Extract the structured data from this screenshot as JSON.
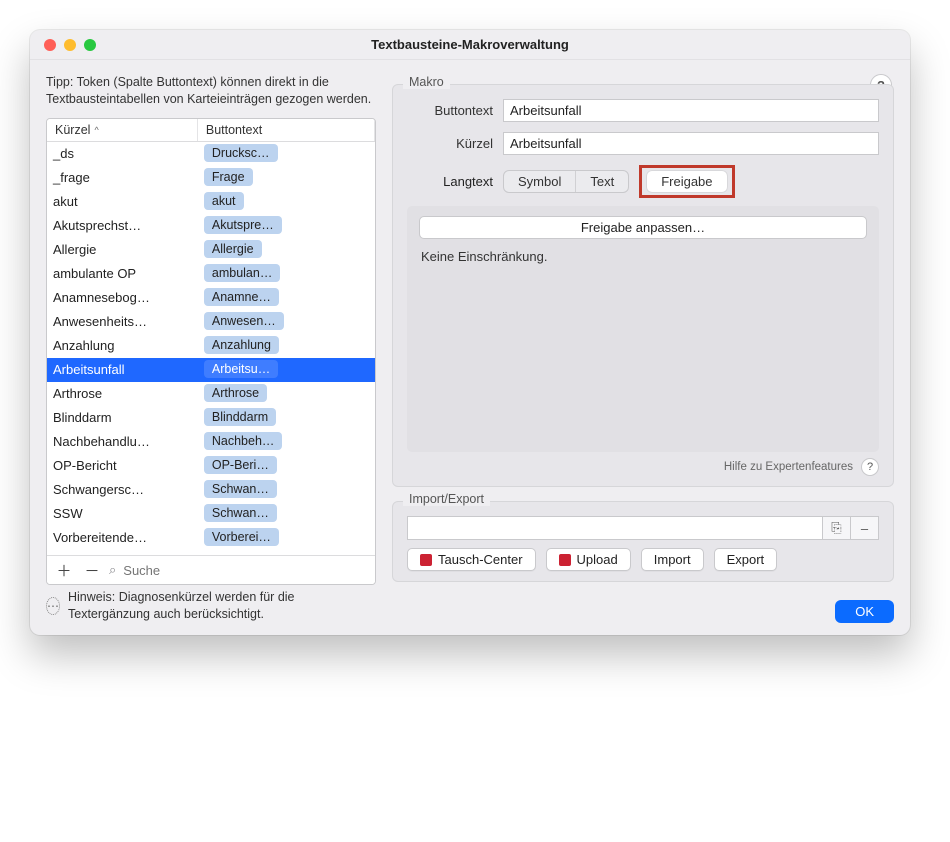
{
  "window": {
    "title": "Textbausteine-Makroverwaltung"
  },
  "left": {
    "tip": "Tipp: Token (Spalte Buttontext) können direkt in die Textbausteintabellen von Karteieinträgen gezogen werden.",
    "columns": {
      "c1": "Kürzel",
      "c2": "Buttontext"
    },
    "sort": "^",
    "rows": [
      {
        "kuerzel": "_ds",
        "button": "Drucksc…"
      },
      {
        "kuerzel": "_frage",
        "button": "Frage"
      },
      {
        "kuerzel": "akut",
        "button": "akut"
      },
      {
        "kuerzel": "Akutsprechst…",
        "button": "Akutspre…"
      },
      {
        "kuerzel": "Allergie",
        "button": "Allergie"
      },
      {
        "kuerzel": "ambulante OP",
        "button": "ambulan…"
      },
      {
        "kuerzel": "Anamnesebog…",
        "button": "Anamne…"
      },
      {
        "kuerzel": "Anwesenheits…",
        "button": "Anwesen…"
      },
      {
        "kuerzel": "Anzahlung",
        "button": "Anzahlung"
      },
      {
        "kuerzel": "Arbeitsunfall",
        "button": "Arbeitsu…",
        "selected": true
      },
      {
        "kuerzel": "Arthrose",
        "button": "Arthrose"
      },
      {
        "kuerzel": "Blinddarm",
        "button": "Blinddarm"
      },
      {
        "kuerzel": "Nachbehandlu…",
        "button": "Nachbeh…"
      },
      {
        "kuerzel": "OP-Bericht",
        "button": "OP-Beri…"
      },
      {
        "kuerzel": "Schwangersc…",
        "button": "Schwan…"
      },
      {
        "kuerzel": "SSW",
        "button": "Schwan…"
      },
      {
        "kuerzel": "Vorbereitende…",
        "button": "Vorberei…"
      }
    ],
    "footer": {
      "add": "＋",
      "remove": "－",
      "search_placeholder": "Suche"
    },
    "hint": "Hinweis: Diagnosenkürzel werden für die Textergänzung auch berücksichtigt."
  },
  "right": {
    "help": "?",
    "makro": {
      "label": "Makro",
      "buttontext_label": "Buttontext",
      "buttontext_value": "Arbeitsunfall",
      "kuerzel_label": "Kürzel",
      "kuerzel_value": "Arbeitsunfall",
      "langtext_label": "Langtext",
      "tabs": {
        "symbol": "Symbol",
        "text": "Text",
        "freigabe": "Freigabe"
      },
      "freigabe_button": "Freigabe anpassen…",
      "restriction_text": "Keine Einschränkung.",
      "expert_label": "Hilfe zu Expertenfeatures",
      "expert_help": "?"
    },
    "importexport": {
      "label": "Import/Export",
      "path": "",
      "browse_icon": "⎘",
      "clear": "–",
      "tausch": "Tausch-Center",
      "upload": "Upload",
      "import": "Import",
      "export": "Export"
    },
    "ok": "OK"
  }
}
